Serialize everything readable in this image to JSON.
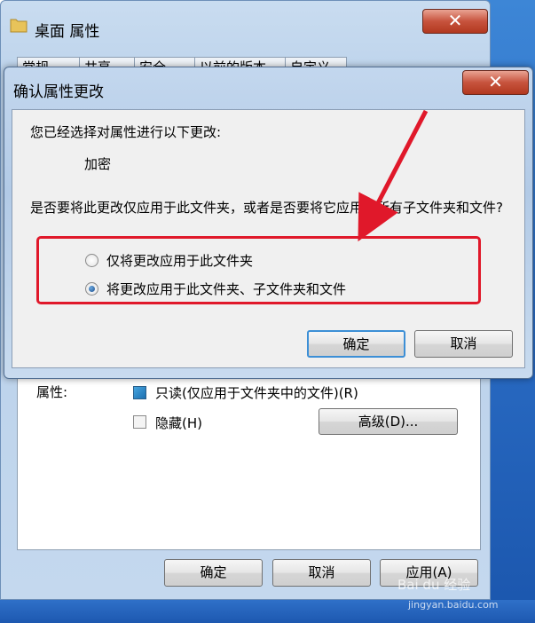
{
  "properties_window": {
    "title": "桌面 属性",
    "close_glyph": "✕",
    "tabs": [
      "常规",
      "共享",
      "安全",
      "以前的版本",
      "自定义"
    ],
    "attributes_label": "属性:",
    "readonly_label": "只读(仅应用于文件夹中的文件)(R)",
    "hidden_label": "隐藏(H)",
    "advanced_button": "高级(D)...",
    "ok_button": "确定",
    "cancel_button": "取消",
    "apply_button": "应用(A)"
  },
  "confirm_dialog": {
    "title": "确认属性更改",
    "close_glyph": "✕",
    "message": "您已经选择对属性进行以下更改:",
    "changed_attribute": "加密",
    "question": "是否要将此更改仅应用于此文件夹，或者是否要将它应用于所有子文件夹和文件?",
    "option_this_folder": "仅将更改应用于此文件夹",
    "option_all": "将更改应用于此文件夹、子文件夹和文件",
    "selected_option": "option_all",
    "ok_button": "确定",
    "cancel_button": "取消"
  },
  "watermark": {
    "brand": "Bai du 经验",
    "url": "jingyan.baidu.com"
  },
  "colors": {
    "highlight": "#e0182a",
    "close_button": "#c7533d"
  }
}
